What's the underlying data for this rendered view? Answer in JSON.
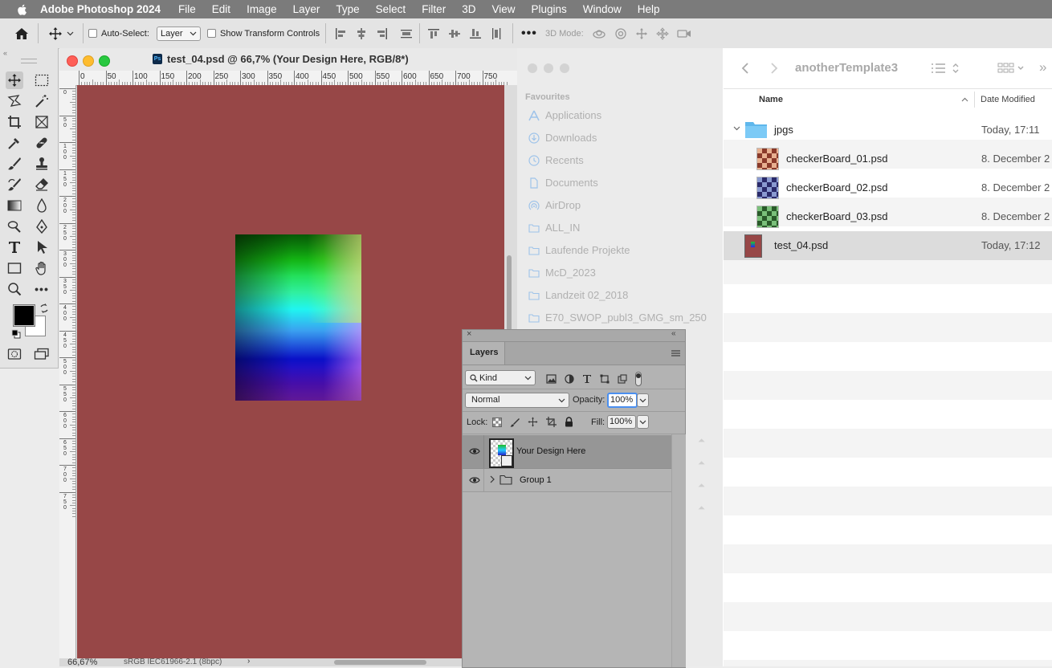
{
  "menubar": {
    "app_name": "Adobe Photoshop 2024",
    "items": [
      "File",
      "Edit",
      "Image",
      "Layer",
      "Type",
      "Select",
      "Filter",
      "3D",
      "View",
      "Plugins",
      "Window",
      "Help"
    ]
  },
  "options_bar": {
    "auto_select_label": "Auto-Select:",
    "auto_select_value": "Layer",
    "transform_controls_label": "Show Transform Controls",
    "mode_3d_label": "3D Mode:"
  },
  "document": {
    "title": "test_04.psd @ 66,7% (Your Design Here, RGB/8*)",
    "zoom": "66,67%",
    "profile": "sRGB IEC61966-2.1 (8bpc)",
    "ruler_h": [
      "0",
      "50",
      "100",
      "150",
      "200",
      "250",
      "300",
      "350",
      "400",
      "450",
      "500",
      "550",
      "600",
      "650",
      "700",
      "750"
    ],
    "ruler_v": [
      "0",
      "5 0",
      "1 0 0",
      "1 5 0",
      "2 0 0",
      "2 5 0",
      "3 0 0",
      "3 5 0",
      "4 0 0",
      "4 5 0",
      "5 0 0",
      "5 5 0",
      "6 0 0",
      "6 5 0",
      "7 0 0",
      "7 5 0"
    ],
    "canvas_color": "#974747"
  },
  "finder": {
    "title": "anotherTemplate3",
    "sidebar_header": "Favourites",
    "sidebar_items": [
      "Applications",
      "Downloads",
      "Recents",
      "Documents",
      "AirDrop",
      "ALL_IN",
      "Laufende Projekte",
      "McD_2023",
      "Landzeit 02_2018",
      "E70_SWOP_publ3_GMG_sm_250"
    ],
    "columns": {
      "name": "Name",
      "date": "Date Modified"
    },
    "rows": [
      {
        "name": "jpgs",
        "date": "Today, 17:11"
      },
      {
        "name": "checkerBoard_01.psd",
        "date": "8. December 2"
      },
      {
        "name": "checkerBoard_02.psd",
        "date": "8. December 2"
      },
      {
        "name": "checkerBoard_03.psd",
        "date": "8. December 2"
      },
      {
        "name": "test_04.psd",
        "date": "Today, 17:12"
      }
    ]
  },
  "layers_panel": {
    "tab": "Layers",
    "filter_kind": "Kind",
    "blend_mode": "Normal",
    "opacity_label": "Opacity:",
    "opacity_value": "100%",
    "lock_label": "Lock:",
    "fill_label": "Fill:",
    "fill_value": "100%",
    "layers": [
      {
        "name": "Your Design Here",
        "visible": true,
        "selected": true
      },
      {
        "name": "Group 1",
        "visible": true,
        "selected": false
      }
    ]
  }
}
